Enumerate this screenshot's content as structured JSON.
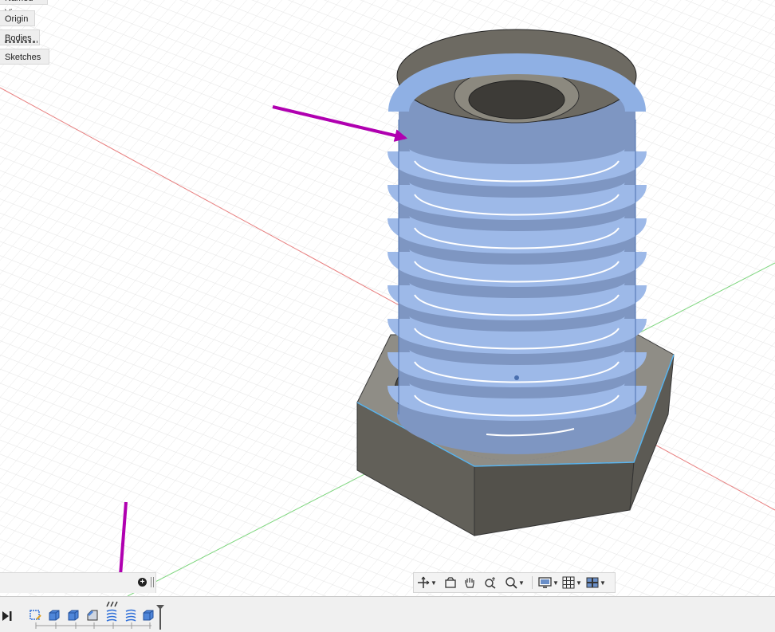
{
  "browser": {
    "items": [
      {
        "label": "Named Views"
      },
      {
        "label": "Origin"
      },
      {
        "label": "Bodies"
      },
      {
        "label": "Sketches"
      }
    ]
  },
  "colors": {
    "annotation_arrow": "#b000b0",
    "body_dark": "#6b6962",
    "coil_blue": "#8fb0e4",
    "grid_line": "#e6e6e6",
    "axis_red": "#e88080",
    "axis_green": "#7ed67e",
    "edge_highlight": "#5ab4ee"
  },
  "navigation_toolbar": {
    "tools": [
      "orbit-icon",
      "look-at-icon",
      "pan-icon",
      "zoom-icon",
      "fit-icon",
      "display-settings-icon",
      "grid-settings-icon",
      "viewports-icon"
    ]
  },
  "timeline": {
    "features": [
      "sketch-feature-icon",
      "extrude-feature-icon",
      "extrude-feature-icon",
      "chamfer-feature-icon",
      "coil-feature-icon",
      "coil-feature-icon",
      "extrude-feature-icon"
    ]
  }
}
